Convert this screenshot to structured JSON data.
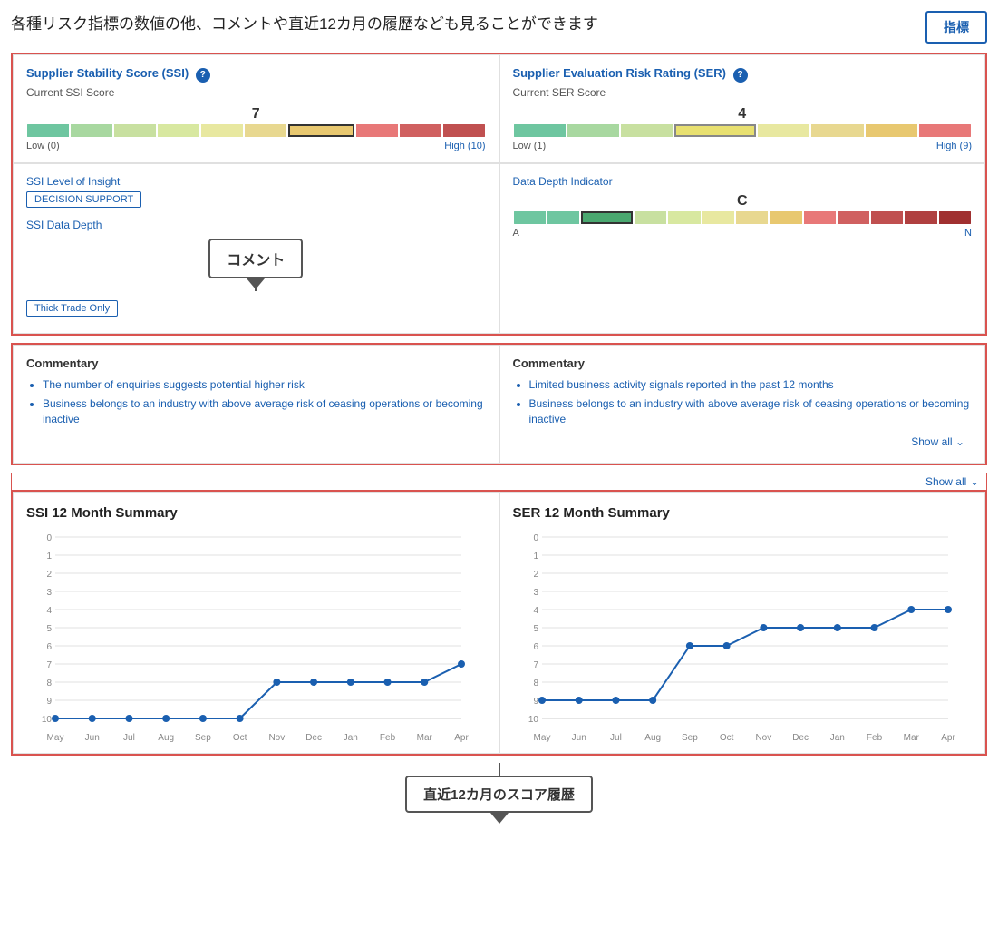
{
  "header": {
    "title": "各種リスク指標の数値の他、コメントや直近12カ月の履歴なども見ることができます",
    "indicator_button": "指標"
  },
  "ssi_panel": {
    "title": "Supplier Stability Score (SSI)",
    "subtitle": "Current SSI Score",
    "score": "7",
    "low_label": "Low (0)",
    "high_label": "High (10)",
    "level_title": "SSI Level of Insight",
    "badge": "DECISION SUPPORT",
    "data_depth_title": "SSI Data Depth",
    "data_depth_badge": "Thick Trade Only"
  },
  "ser_panel": {
    "title": "Supplier Evaluation Risk Rating (SER)",
    "subtitle": "Current SER Score",
    "score": "4",
    "low_label": "Low (1)",
    "high_label": "High (9)",
    "ddi_title": "Data Depth Indicator",
    "ddi_value": "C",
    "ddi_low": "A",
    "ddi_high": "N"
  },
  "commentary_ssi": {
    "title": "Commentary",
    "items": [
      "The number of enquiries suggests potential higher risk",
      "Business belongs to an industry with above average risk of ceasing operations or becoming inactive"
    ]
  },
  "commentary_ser": {
    "title": "Commentary",
    "items": [
      "Limited business activity signals reported in the past 12 months",
      "Business belongs to an industry with above average risk of ceasing operations or becoming inactive"
    ]
  },
  "show_all": "Show all",
  "ssi_chart": {
    "title": "SSI 12 Month Summary",
    "months": [
      "May",
      "Jun",
      "Jul",
      "Aug",
      "Sep",
      "Oct",
      "Nov",
      "Dec",
      "Jan",
      "Feb",
      "Mar",
      "Apr"
    ],
    "values": [
      10,
      10,
      10,
      10,
      10,
      10,
      8,
      8,
      8,
      8,
      8,
      7
    ],
    "y_labels": [
      "0",
      "1",
      "2",
      "3",
      "4",
      "5",
      "6",
      "7",
      "8",
      "9",
      "10"
    ]
  },
  "ser_chart": {
    "title": "SER 12 Month Summary",
    "months": [
      "May",
      "Jun",
      "Jul",
      "Aug",
      "Sep",
      "Oct",
      "Nov",
      "Dec",
      "Jan",
      "Feb",
      "Mar",
      "Apr"
    ],
    "values": [
      9,
      9,
      9,
      9,
      6,
      6,
      5,
      5,
      5,
      5,
      4,
      4
    ],
    "y_labels": [
      "0",
      "1",
      "2",
      "3",
      "4",
      "5",
      "6",
      "7",
      "8",
      "9",
      "10"
    ]
  },
  "comment_callout": "コメント",
  "history_callout": "直近12カ月のスコア履歴",
  "gauge_colors_ssi": [
    "#6ec6a0",
    "#a8d8a0",
    "#c8e0a0",
    "#d8e8a0",
    "#e8e8a0",
    "#e8d890",
    "#e8c870",
    "#e87878",
    "#d06060",
    "#c05050"
  ],
  "gauge_colors_ser": [
    "#6ec6a0",
    "#a8d8a0",
    "#c8e0a0",
    "#d8e8a0",
    "#e8e8a0",
    "#e8d890",
    "#e8c870",
    "#e87878"
  ],
  "gauge_ddi_colors": [
    "#6ec6a0",
    "#6ec6a0",
    "#a8d8a0",
    "#c8e0a0",
    "#d8e8a0",
    "#e8e8a0",
    "#e8d890",
    "#e8c870",
    "#e87878",
    "#d06060",
    "#c05050",
    "#b04040",
    "#a03030"
  ]
}
